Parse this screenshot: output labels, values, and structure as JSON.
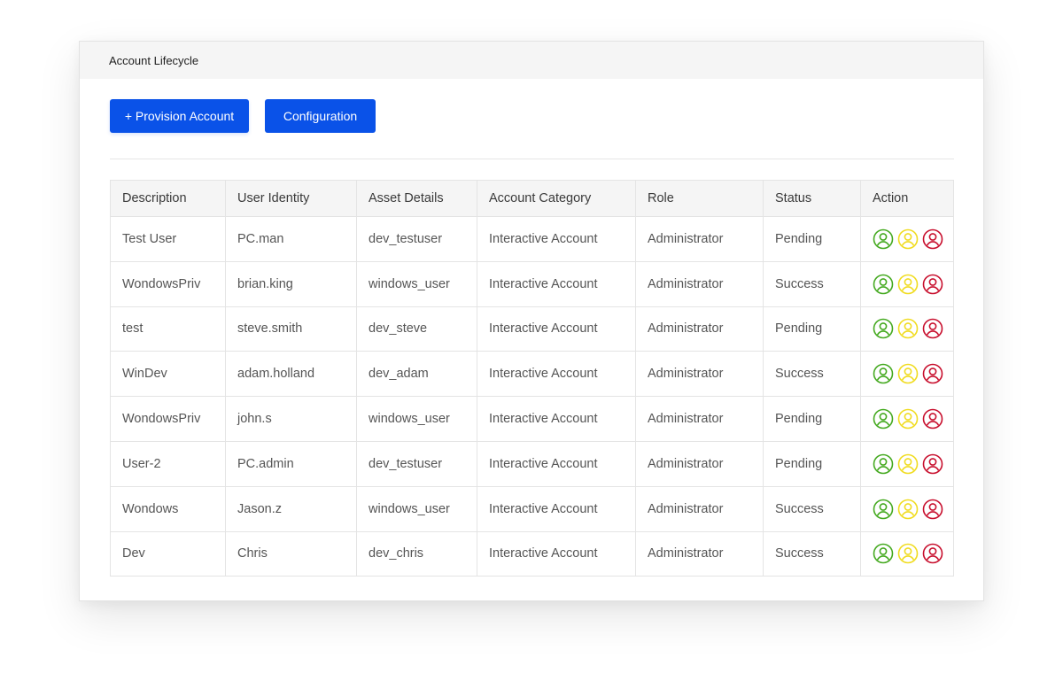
{
  "window": {
    "title": "Account Lifecycle"
  },
  "toolbar": {
    "provision_label": "+ Provision Account",
    "configuration_label": "Configuration"
  },
  "colors": {
    "primary": "#0a52e8",
    "approve_icon": "#44a91f",
    "pending_icon": "#f0dc20",
    "reject_icon": "#c8102e"
  },
  "table": {
    "headers": [
      "Description",
      "User Identity",
      "Asset Details",
      "Account Category",
      "Role",
      "Status",
      "Action"
    ],
    "rows": [
      [
        "Test User",
        "PC.man",
        "dev_testuser",
        "Interactive Account",
        "Administrator",
        "Pending"
      ],
      [
        "WondowsPriv",
        "brian.king",
        "windows_user",
        "Interactive Account",
        "Administrator",
        "Success"
      ],
      [
        "test",
        "steve.smith",
        "dev_steve",
        "Interactive Account",
        "Administrator",
        "Pending"
      ],
      [
        "WinDev",
        "adam.holland",
        "dev_adam",
        "Interactive Account",
        "Administrator",
        "Success"
      ],
      [
        "WondowsPriv",
        "john.s",
        "windows_user",
        "Interactive Account",
        "Administrator",
        "Pending"
      ],
      [
        "User-2",
        "PC.admin",
        "dev_testuser",
        "Interactive Account",
        "Administrator",
        "Pending"
      ],
      [
        "Wondows",
        "Jason.z",
        "windows_user",
        "Interactive Account",
        "Administrator",
        "Success"
      ],
      [
        "Dev",
        "Chris",
        "dev_chris",
        "Interactive Account",
        "Administrator",
        "Success"
      ]
    ],
    "action_icons": [
      "user-approve-icon",
      "user-pending-icon",
      "user-reject-icon"
    ]
  }
}
